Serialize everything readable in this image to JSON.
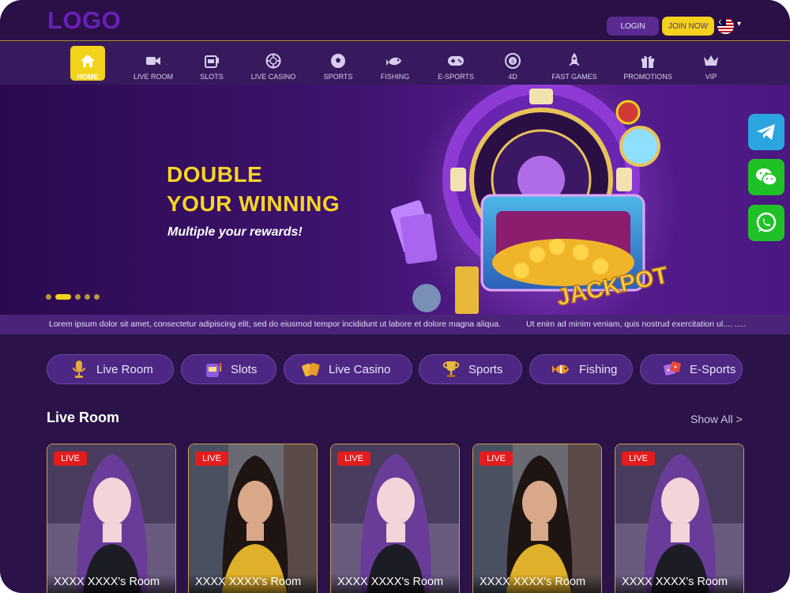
{
  "header": {
    "logo": "LOGO",
    "login_label": "LOGIN",
    "join_label": "JOIN NOW",
    "language_icon": "malaysia-flag-icon"
  },
  "nav": {
    "items": [
      {
        "label": "HOME",
        "icon": "home-icon",
        "active": true
      },
      {
        "label": "LIVE ROOM",
        "icon": "video-camera-icon"
      },
      {
        "label": "SLOTS",
        "icon": "slot-machine-icon"
      },
      {
        "label": "LIVE CASINO",
        "icon": "casino-chip-icon"
      },
      {
        "label": "SPORTS",
        "icon": "soccer-ball-icon"
      },
      {
        "label": "FISHING",
        "icon": "fish-icon"
      },
      {
        "label": "E-SPORTS",
        "icon": "gamepad-icon"
      },
      {
        "label": "4D",
        "icon": "lottery-ball-icon"
      },
      {
        "label": "FAST GAMES",
        "icon": "rocket-icon"
      },
      {
        "label": "PROMOTIONS",
        "icon": "gift-icon"
      },
      {
        "label": "VIP",
        "icon": "crown-icon"
      }
    ]
  },
  "banner": {
    "title_line1": "DOUBLE",
    "title_line2": "YOUR WINNING",
    "subtitle": "Multiple your rewards!",
    "art_label": "JACKPOT",
    "slide_count": 5,
    "active_slide": 2
  },
  "marquee": {
    "text1": "Lorem ipsum dolor sit amet, consectetur adipiscing elit, sed do eiusmod tempor incididunt ut labore et dolore magna aliqua.",
    "text2": "Ut enim ad minim veniam, quis nostrud exercitation ul.... ....."
  },
  "social": [
    "telegram-icon",
    "wechat-icon",
    "whatsapp-icon"
  ],
  "categories": [
    {
      "label": "Live Room",
      "icon": "microphone-icon"
    },
    {
      "label": "Slots",
      "icon": "slot-machine-icon"
    },
    {
      "label": "Live Casino",
      "icon": "cards-icon"
    },
    {
      "label": "Sports",
      "icon": "trophy-icon"
    },
    {
      "label": "Fishing",
      "icon": "fish-icon"
    },
    {
      "label": "E-Sports",
      "icon": "dice-icon"
    }
  ],
  "live_section": {
    "title": "Live Room",
    "show_all": "Show All >",
    "badge": "LIVE",
    "rooms": [
      {
        "name": "XXXX XXXX's Room"
      },
      {
        "name": "XXXX XXXX's Room"
      },
      {
        "name": "XXXX XXXX's Room"
      },
      {
        "name": "XXXX XXXX's Room"
      },
      {
        "name": "XXXX XXXX's Room"
      }
    ]
  },
  "colors": {
    "background": "#2b1248",
    "accent_yellow": "#f2d21a",
    "gold_border": "#c9a24a",
    "live_red": "#e31d1d"
  }
}
